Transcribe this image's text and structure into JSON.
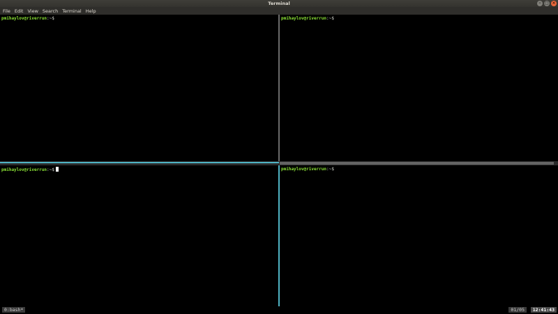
{
  "window": {
    "title": "Terminal"
  },
  "menu": [
    "File",
    "Edit",
    "View",
    "Search",
    "Terminal",
    "Help"
  ],
  "panes": [
    {
      "user_host": "pmihaylov@riverrun",
      "path": ":~$"
    },
    {
      "user_host": "pmihaylov@riverrun",
      "path": ":~$"
    },
    {
      "user_host": "pmihaylov@riverrun",
      "path": ":~$"
    },
    {
      "user_host": "pmihaylov@riverrun",
      "path": ":~$"
    }
  ],
  "status": {
    "tab": "0:bash*",
    "position": "01/05",
    "clock": "12:41:43"
  },
  "colors": {
    "prompt": "#8ae234",
    "active_border": "#4fb3c4"
  }
}
